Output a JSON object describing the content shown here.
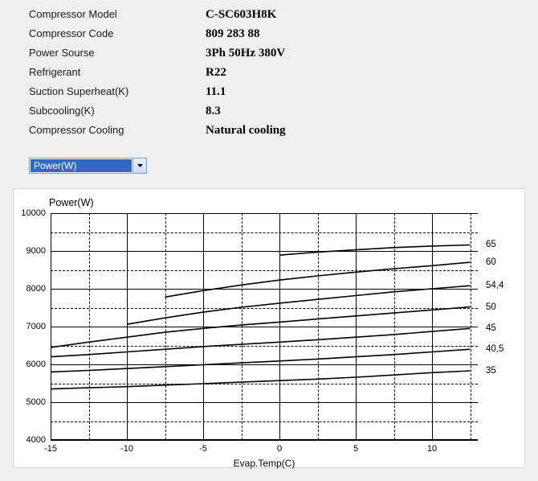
{
  "specs": {
    "rows": [
      {
        "label": "Compressor  Model",
        "value": "C-SC603H8K"
      },
      {
        "label": "Compressor Code",
        "value": "809 283 88"
      },
      {
        "label": "Power Sourse",
        "value": "3Ph  50Hz  380V"
      },
      {
        "label": "Refrigerant",
        "value": "R22"
      },
      {
        "label": "Suction Superheat(K)",
        "value": "11.1"
      },
      {
        "label": "Subcooling(K)",
        "value": "8.3"
      },
      {
        "label": "Compressor Cooling",
        "value": "Natural cooling"
      }
    ]
  },
  "dropdown": {
    "selected": "Power(W)"
  },
  "chart_data": {
    "type": "line",
    "title": "Power(W)",
    "xlabel": "Evap.Temp(C)",
    "ylabel": "",
    "xlim": [
      -15,
      13
    ],
    "ylim": [
      4000,
      10000
    ],
    "x_ticks": [
      -15,
      -10,
      -5,
      0,
      5,
      10
    ],
    "y_ticks": [
      4000,
      5000,
      6000,
      7000,
      8000,
      9000,
      10000
    ],
    "x": [
      -15,
      -12.5,
      -10,
      -7.5,
      -5,
      -2.5,
      0,
      2.5,
      5,
      7.5,
      10,
      12.5
    ],
    "series": [
      {
        "name": "35",
        "values": [
          5350,
          5380,
          5410,
          5450,
          5490,
          5530,
          5570,
          5610,
          5660,
          5720,
          5780,
          5830
        ]
      },
      {
        "name": "40,5",
        "values": [
          5800,
          5840,
          5890,
          5940,
          5990,
          6040,
          6090,
          6140,
          6200,
          6260,
          6330,
          6400
        ]
      },
      {
        "name": "45",
        "values": [
          6200,
          6260,
          6330,
          6400,
          6470,
          6530,
          6590,
          6650,
          6720,
          6790,
          6870,
          6950
        ]
      },
      {
        "name": "50",
        "values": [
          6450,
          6590,
          6720,
          6850,
          6950,
          7040,
          7120,
          7200,
          7280,
          7360,
          7440,
          7520
        ]
      },
      {
        "name": "54,4",
        "values": [
          null,
          null,
          7060,
          7230,
          7380,
          7510,
          7620,
          7720,
          7820,
          7920,
          8000,
          8080
        ]
      },
      {
        "name": "60",
        "values": [
          null,
          null,
          null,
          7780,
          7950,
          8100,
          8230,
          8340,
          8440,
          8530,
          8610,
          8700
        ]
      },
      {
        "name": "65",
        "values": [
          null,
          null,
          null,
          null,
          null,
          null,
          8890,
          8970,
          9030,
          9090,
          9130,
          9160
        ]
      }
    ]
  }
}
